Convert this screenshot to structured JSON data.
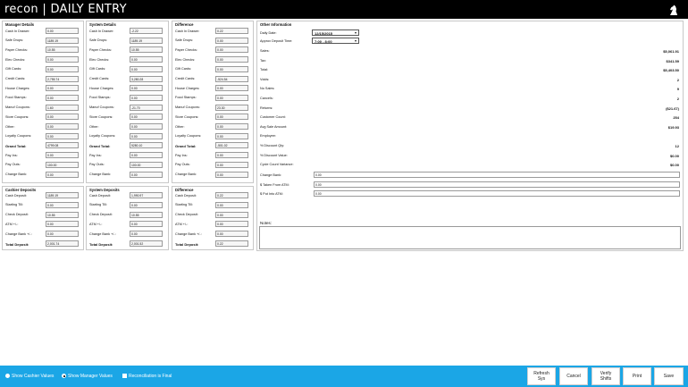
{
  "app": {
    "title": "recon | DAILY ENTRY"
  },
  "manager": {
    "title": "Manager Details",
    "rows": [
      {
        "label": "Cash In Drawer:",
        "value": "0.00"
      },
      {
        "label": "Safe Drops:",
        "value": "1189.19"
      },
      {
        "label": "Paper Checks:",
        "value": "10.55"
      },
      {
        "label": "Elec Checks:",
        "value": "0.00"
      },
      {
        "label": "Gift Cards:",
        "value": "0.00"
      },
      {
        "label": "Credit Cards:",
        "value": "2,755.74"
      },
      {
        "label": "House Charges:",
        "value": "0.00"
      },
      {
        "label": "Food Stamps:",
        "value": "0.00"
      },
      {
        "label": "Manuf Coupons:",
        "value": "1.60"
      },
      {
        "label": "Store Coupons:",
        "value": "0.00"
      },
      {
        "label": "Other:",
        "value": "0.00"
      },
      {
        "label": "Loyalty Coupons:",
        "value": "0.00"
      },
      {
        "label": "Grand Total:",
        "value": "4799.08",
        "bold": true
      },
      {
        "label": "Pay Ins:",
        "value": "0.00"
      },
      {
        "label": "Pay Outs:",
        "value": "100.00"
      },
      {
        "label": "Change Bank:",
        "value": "0.00"
      }
    ]
  },
  "system": {
    "title": "System Details",
    "rows": [
      {
        "label": "Cash In Drawer:",
        "value": "-2.22"
      },
      {
        "label": "Safe Drops:",
        "value": "1189.19"
      },
      {
        "label": "Paper Checks:",
        "value": "10.55"
      },
      {
        "label": "Elec Checks:",
        "value": "0.00"
      },
      {
        "label": "Gift Cards:",
        "value": "0.00"
      },
      {
        "label": "Credit Cards:",
        "value": "3,280.28"
      },
      {
        "label": "House Charges:",
        "value": "0.00"
      },
      {
        "label": "Food Stamps:",
        "value": "0.00"
      },
      {
        "label": "Manuf Coupons:",
        "value": "-21.70"
      },
      {
        "label": "Store Coupons:",
        "value": "0.00"
      },
      {
        "label": "Other:",
        "value": "0.00"
      },
      {
        "label": "Loyalty Coupons:",
        "value": "0.00"
      },
      {
        "label": "Grand Total:",
        "value": "5280.10",
        "bold": true
      },
      {
        "label": "Pay Ins:",
        "value": "0.00"
      },
      {
        "label": "Pay Outs:",
        "value": "100.00"
      },
      {
        "label": "Change Bank:",
        "value": "0.00"
      }
    ]
  },
  "difference": {
    "title": "Difference",
    "rows": [
      {
        "label": "Cash In Drawer:",
        "value": "0.22"
      },
      {
        "label": "Safe Drops:",
        "value": "0.00"
      },
      {
        "label": "Paper Checks:",
        "value": "0.00"
      },
      {
        "label": "Elec Checks:",
        "value": "0.00"
      },
      {
        "label": "Gift Cards:",
        "value": "0.00"
      },
      {
        "label": "Credit Cards:",
        "value": "-524.54"
      },
      {
        "label": "House Charges:",
        "value": "0.00"
      },
      {
        "label": "Food Stamps:",
        "value": "0.00"
      },
      {
        "label": "Manuf Coupons:",
        "value": "23.30"
      },
      {
        "label": "Store Coupons:",
        "value": "0.00"
      },
      {
        "label": "Other:",
        "value": "0.00"
      },
      {
        "label": "Loyalty Coupons:",
        "value": "0.00"
      },
      {
        "label": "Grand Total:",
        "value": "-501.02",
        "bold": true
      },
      {
        "label": "Pay Ins:",
        "value": "0.00"
      },
      {
        "label": "Pay Outs:",
        "value": "0.00"
      },
      {
        "label": "Change Bank:",
        "value": "0.00"
      }
    ]
  },
  "cashier_deposits": {
    "title": "Cashier Deposits",
    "rows": [
      {
        "label": "Cash Deposit:",
        "value": "1189.19"
      },
      {
        "label": "Starting Till:",
        "value": "0.00"
      },
      {
        "label": "Check Deposit:",
        "value": "10.55"
      },
      {
        "label": "ATM +/-:",
        "value": "0.00"
      },
      {
        "label": "Change Bank +/-:",
        "value": "0.00"
      },
      {
        "label": "Total Deposit:",
        "value": "2,001.74",
        "bold": true
      }
    ]
  },
  "system_deposits": {
    "title": "System Deposits",
    "rows": [
      {
        "label": "Cash Deposit:",
        "value": "1,990.97"
      },
      {
        "label": "Starting Till:",
        "value": "0.00"
      },
      {
        "label": "Check Deposit:",
        "value": "10.55"
      },
      {
        "label": "ATM +/-:",
        "value": "0.00"
      },
      {
        "label": "Change Bank +/-:",
        "value": "0.00"
      },
      {
        "label": "Total Deposit:",
        "value": "2,001.52",
        "bold": true
      }
    ]
  },
  "difference_deposits": {
    "title": "Difference",
    "rows": [
      {
        "label": "Cash Deposit:",
        "value": "0.22"
      },
      {
        "label": "Starting Till:",
        "value": "0.00"
      },
      {
        "label": "Check Deposit:",
        "value": "0.00"
      },
      {
        "label": "ATM +/-:",
        "value": "0.00"
      },
      {
        "label": "Change Bank +/-:",
        "value": "0.00"
      },
      {
        "label": "Total Deposit:",
        "value": "0.22",
        "bold": true
      }
    ]
  },
  "other": {
    "title": "Other Information",
    "daily_date_label": "Daily Date:",
    "daily_date": "12/15/2015",
    "deposit_time_label": "Approx Deposit Time:",
    "deposit_time": "7:00 - 8:00",
    "stats": [
      {
        "label": "Sales:",
        "value": "$5,061.91"
      },
      {
        "label": "Tax:",
        "value": "$341.59"
      },
      {
        "label": "Total:",
        "value": "$5,403.50"
      },
      {
        "label": "Voids:",
        "value": "2"
      },
      {
        "label": "No Sales:",
        "value": "9"
      },
      {
        "label": "Cancels:",
        "value": "2"
      },
      {
        "label": "Returns:",
        "value": "($21.67)"
      },
      {
        "label": "Customer Count:",
        "value": "254"
      },
      {
        "label": "Avg Sale Amount:",
        "value": "$19.93"
      },
      {
        "label": "Employee:",
        "value": ""
      },
      {
        "label": "% Discount Qty:",
        "value": "12"
      },
      {
        "label": "% Discount Value:",
        "value": "$0.00"
      },
      {
        "label": "Cycle Count Variance:",
        "value": "$0.00"
      }
    ],
    "fields": [
      {
        "label": "Change Bank:",
        "value": "0.00"
      },
      {
        "label": "$ Taken From ATM:",
        "value": "0.00"
      },
      {
        "label": "$ Put Into ATM:",
        "value": "0.00"
      }
    ],
    "notes_label": "Notes:"
  },
  "footer": {
    "show_cashier": "Show Cashier Values",
    "show_manager": "Show Manager Values",
    "reconciliation_final": "Reconciliation is Final",
    "refresh": "Refresh\nSys",
    "cancel": "Cancel",
    "verify": "Verify\nShifts",
    "print": "Print",
    "save": "Save"
  }
}
